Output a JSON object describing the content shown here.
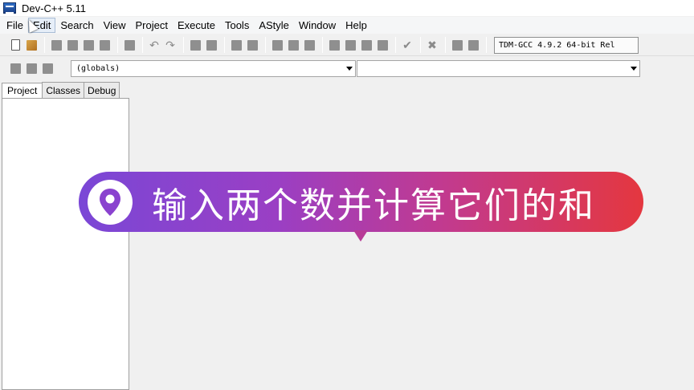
{
  "window": {
    "title": "Dev-C++ 5.11"
  },
  "menu": {
    "items": [
      "File",
      "Edit",
      "Search",
      "View",
      "Project",
      "Execute",
      "Tools",
      "AStyle",
      "Window",
      "Help"
    ]
  },
  "toolbar": {
    "compiler_label": "TDM-GCC 4.9.2 64-bit Rel"
  },
  "class_browser": {
    "scope_value": "(globals)",
    "member_value": ""
  },
  "side_tabs": [
    "Project",
    "Classes",
    "Debug"
  ],
  "banner": {
    "text": "输入两个数并计算它们的和",
    "icon": "location-pin-icon",
    "gradient_start": "#7a47d6",
    "gradient_end": "#e4373f"
  }
}
